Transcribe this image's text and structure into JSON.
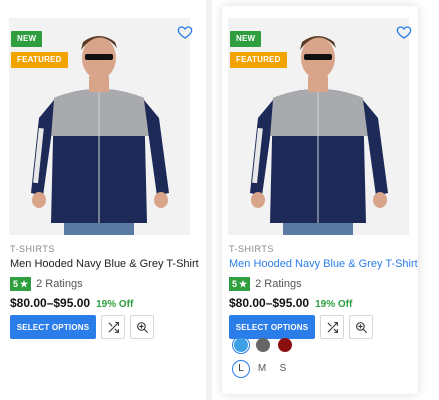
{
  "products": [
    {
      "badges": {
        "new": "NEW",
        "featured": "FEATURED"
      },
      "wishlist_icon": "heart-icon",
      "category": "T-SHIRTS",
      "title": "Men Hooded Navy Blue & Grey T-Shirt",
      "rating": "5",
      "ratings_text": "2 Ratings",
      "price": "$80.00–$95.00",
      "discount": "19% Off",
      "select_options_label": "SELECT OPTIONS",
      "compare_icon": "shuffle-icon",
      "quickview_icon": "zoom-in-icon",
      "title_color": "#222222"
    },
    {
      "badges": {
        "new": "NEW",
        "featured": "FEATURED"
      },
      "wishlist_icon": "heart-icon",
      "category": "T-SHIRTS",
      "title": "Men Hooded Navy Blue & Grey T-Shirt",
      "rating": "5",
      "ratings_text": "2 Ratings",
      "price": "$80.00–$95.00",
      "discount": "19% Off",
      "select_options_label": "SELECT OPTIONS",
      "compare_icon": "shuffle-icon",
      "quickview_icon": "zoom-in-icon",
      "title_color": "#2b7de9",
      "color_swatches": [
        {
          "name": "blue",
          "color": "#3ea1e8",
          "selected": true
        },
        {
          "name": "grey",
          "color": "#666666",
          "selected": false
        },
        {
          "name": "red",
          "color": "#8b0e0e",
          "selected": false
        }
      ],
      "sizes": [
        {
          "label": "L",
          "selected": true
        },
        {
          "label": "M",
          "selected": false
        },
        {
          "label": "S",
          "selected": false
        }
      ]
    }
  ],
  "colors": {
    "accent": "#2b7de9",
    "rating_green": "#2e9e3f",
    "featured_orange": "#f2a300"
  }
}
